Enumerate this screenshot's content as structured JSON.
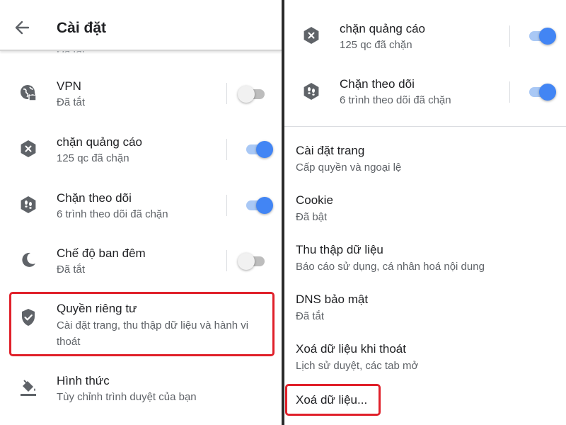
{
  "header": {
    "title": "Cài đặt",
    "clipped_text": "Đã tắt"
  },
  "left_rows": [
    {
      "title": "VPN",
      "subtitle": "Đã tắt",
      "toggle": "off",
      "icon": "globe-lock-icon"
    },
    {
      "title": "chặn quảng cáo",
      "subtitle": "125 qc đã chặn",
      "toggle": "on",
      "icon": "ad-block-icon"
    },
    {
      "title": "Chặn theo dõi",
      "subtitle": "6 trình theo dõi đã chặn",
      "toggle": "on",
      "icon": "footprints-icon"
    },
    {
      "title": "Chế độ ban đêm",
      "subtitle": "Đã tắt",
      "toggle": "off",
      "icon": "moon-icon"
    },
    {
      "title": "Quyền riêng tư",
      "subtitle_line1": "Cài đặt trang, thu thập dữ liệu và hành vi",
      "subtitle_line2": "thoát",
      "icon": "shield-check-icon"
    },
    {
      "title": "Hình thức",
      "subtitle": "Tùy chỉnh trình duyệt của bạn",
      "icon": "paint-bucket-icon"
    }
  ],
  "right_rows": [
    {
      "title": "chặn quảng cáo",
      "subtitle": "125 qc đã chặn",
      "toggle": "on",
      "icon": "ad-block-icon"
    },
    {
      "title": "Chặn theo dõi",
      "subtitle": "6 trình theo dõi đã chặn",
      "toggle": "on",
      "icon": "footprints-icon"
    }
  ],
  "privacy_items": [
    {
      "title": "Cài đặt trang",
      "subtitle": "Cấp quyền và ngoại lệ"
    },
    {
      "title": "Cookie",
      "subtitle": "Đã bật"
    },
    {
      "title": "Thu thập dữ liệu",
      "subtitle": "Báo cáo sử dụng, cá nhân hoá nội dung"
    },
    {
      "title": "DNS bảo mật",
      "subtitle": "Đã tắt"
    },
    {
      "title": "Xoá dữ liệu khi thoát",
      "subtitle": "Lịch sử duyệt, các tab mở"
    },
    {
      "title": "Xoá dữ liệu..."
    }
  ],
  "colors": {
    "accent": "#4285f4",
    "highlight_box": "#e0202a",
    "icon_gray": "#5f6368",
    "text_primary": "#202124",
    "text_secondary": "#5f6368"
  }
}
